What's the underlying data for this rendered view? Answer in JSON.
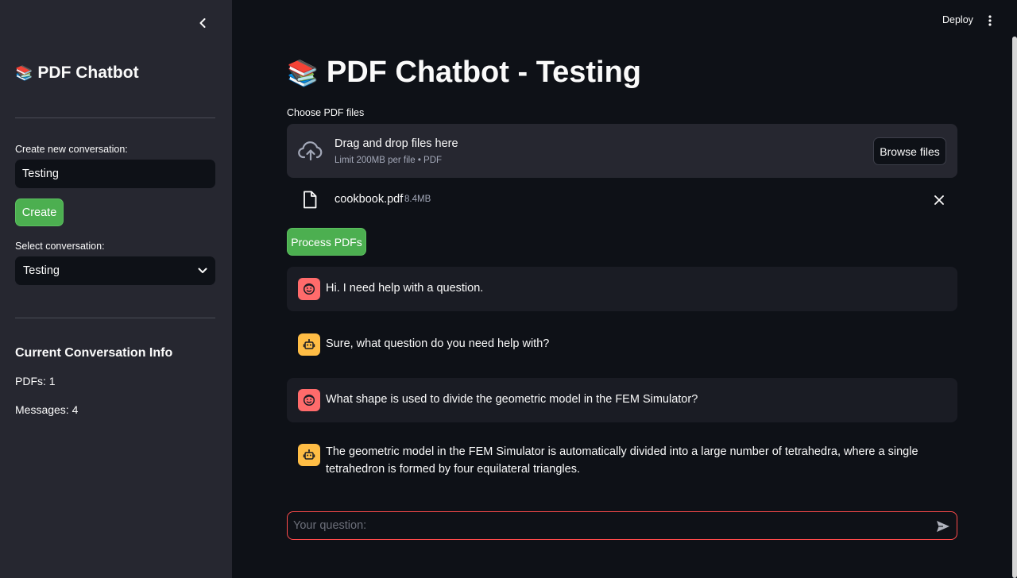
{
  "sidebar": {
    "title_icon": "books-emoji",
    "title_emoji": "📚",
    "title": "PDF Chatbot",
    "create_label": "Create new conversation:",
    "create_value": "Testing",
    "create_button": "Create",
    "select_label": "Select conversation:",
    "select_value": "Testing",
    "info_heading": "Current Conversation Info",
    "pdfs": "PDFs: 1",
    "messages": "Messages: 4"
  },
  "topbar": {
    "deploy": "Deploy"
  },
  "main": {
    "title_emoji": "📚",
    "title": "PDF Chatbot - Testing",
    "uploader": {
      "label": "Choose PDF files",
      "drop_text": "Drag and drop files here",
      "limit_text": "Limit 200MB per file • PDF",
      "browse_button": "Browse files"
    },
    "file": {
      "name": "cookbook.pdf",
      "size": "8.4MB"
    },
    "process_button": "Process PDFs",
    "messages": [
      {
        "role": "user",
        "text": "Hi. I need help with a question."
      },
      {
        "role": "assistant",
        "text": "Sure, what question do you need help with?"
      },
      {
        "role": "user",
        "text": "What shape is used to divide the geometric model in the FEM Simulator?"
      },
      {
        "role": "assistant",
        "text": "The geometric model in the FEM Simulator is automatically divided into a large number of tetrahedra, where a single tetrahedron is formed by four equilateral triangles."
      }
    ],
    "chat_input": {
      "placeholder": "Your question:",
      "value": ""
    }
  },
  "colors": {
    "background": "#0e1117",
    "sidebar": "#262730",
    "primary_green": "#4caf50",
    "user_avatar": "#ff6b6b",
    "bot_avatar": "#ffbd45",
    "input_border": "#ff4b4b"
  }
}
